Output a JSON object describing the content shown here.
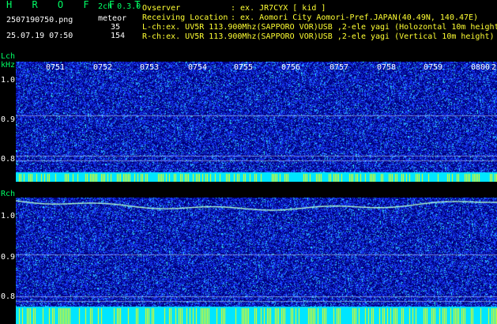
{
  "header": {
    "brand": "H R O F F T",
    "mode": "2ch 0.3.0",
    "filename": "2507190750.png",
    "datetime": "25.07.19 07:50",
    "meteor_label": "meteor",
    "count_l": "35",
    "count_r": "154",
    "observer_label": "Ovserver",
    "observer_value": ": ex. JR7CYX [ kid ]",
    "location_label": "Receiving Location",
    "location_value": ": ex. Aomori City Aomori-Pref.JAPAN(40.49N, 140.47E)",
    "lch_line": "L-ch:ex. UV5R 113.900Mhz(SAPPORO VOR)USB ,2-ele yagi (Holozontal 10m height",
    "rch_line": "R-ch:ex. UV5R 113.900Mhz(SAPPORO VOR)USB ,2-ele yagi (Vertical 10m height)"
  },
  "lch_panel": {
    "label": "Lch",
    "unit": "kHz",
    "y_ticks": [
      "1.0",
      "0.9",
      "0.8"
    ],
    "time_ticks": [
      "0751",
      "0752",
      "0753",
      "0754",
      "0755",
      "0756",
      "0757",
      "0758",
      "0759",
      "0800"
    ],
    "edge_label": "2"
  },
  "rch_panel": {
    "label": "Rch",
    "y_ticks": [
      "1.0",
      "0.9",
      "0.8"
    ]
  },
  "colors": {
    "noise_dark": "#00007a",
    "noise_mid": "#1a3dff",
    "noise_bright": "#33e6ff",
    "trace": "#b0ffd0",
    "cyan_bar": "#00e5ff",
    "yellow_bar": "#ffff00",
    "text_green": "#00ff66",
    "text_yellow": "#ffff33"
  }
}
